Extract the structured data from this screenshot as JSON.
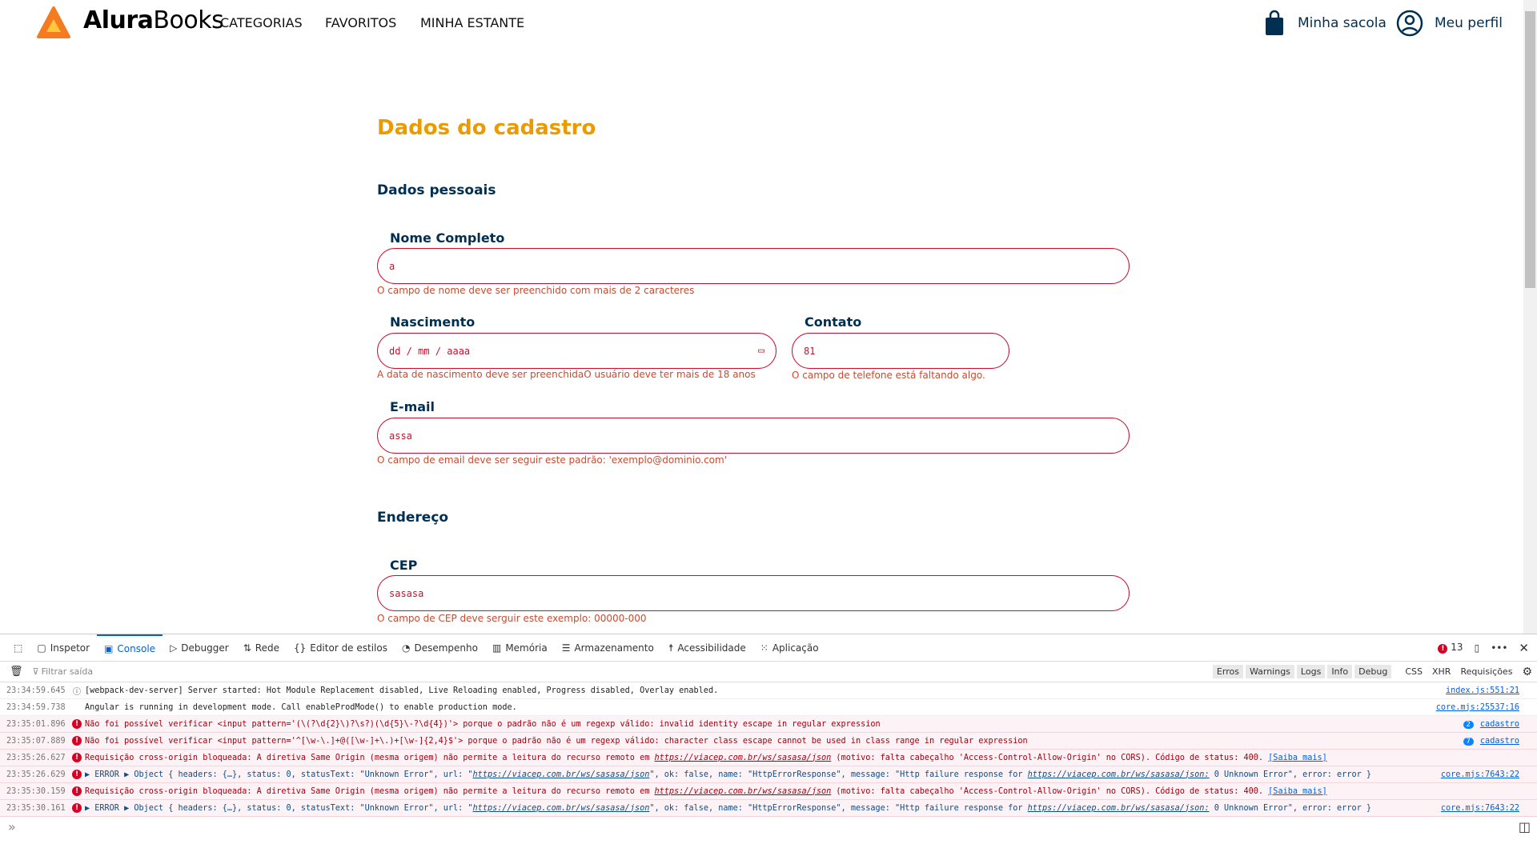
{
  "header": {
    "brand_bold": "Alura",
    "brand_rest": "Books",
    "nav": [
      "CATEGORIAS",
      "FAVORITOS",
      "MINHA ESTANTE"
    ],
    "bag": "Minha sacola",
    "profile": "Meu perfil"
  },
  "form": {
    "title": "Dados do cadastro",
    "personal": "Dados pessoais",
    "nome": {
      "label": "Nome Completo",
      "value": "a",
      "error": "O campo de nome deve ser preenchido com mais de 2 caracteres"
    },
    "nascimento": {
      "label": "Nascimento",
      "placeholder": "dd / mm / aaaa",
      "error": "A data de nascimento deve ser preenchidaO usuário deve ter mais de 18 anos"
    },
    "contato": {
      "label": "Contato",
      "value": "81",
      "error": "O campo de telefone está faltando algo."
    },
    "email": {
      "label": "E-mail",
      "value": "assa",
      "error": "O campo de email deve ser seguir este padrão: 'exemplo@dominio.com'"
    },
    "address": "Endereço",
    "cep": {
      "label": "CEP",
      "value": "sasasa",
      "error": "O campo de CEP deve serguir este exemplo: 00000-000"
    }
  },
  "devtools": {
    "tabs": [
      "Inspetor",
      "Console",
      "Debugger",
      "Rede",
      "Editor de estilos",
      "Desempenho",
      "Memória",
      "Armazenamento",
      "Acessibilidade",
      "Aplicação"
    ],
    "active_tab": "Console",
    "error_count": "13",
    "filter_placeholder": "Filtrar saída",
    "levels": [
      "Erros",
      "Warnings",
      "Logs",
      "Info",
      "Debug"
    ],
    "extras": [
      "CSS",
      "XHR",
      "Requisições"
    ],
    "logs": [
      {
        "time": "23:34:59.645",
        "type": "info",
        "text": "[webpack-dev-server] Server started: Hot Module Replacement disabled, Live Reloading enabled, Progress disabled, Overlay enabled.",
        "source": "index.js:551:21"
      },
      {
        "time": "23:34:59.738",
        "type": "log",
        "text": "Angular is running in development mode. Call enableProdMode() to enable production mode.",
        "source": "core.mjs:25537:16"
      },
      {
        "time": "23:35:01.896",
        "type": "error",
        "text": "Não foi possível verificar <input pattern='(\\(?\\d{2}\\)?\\s?)(\\d{5}\\-?\\d{4})'> porque o padrão não é um regexp válido: invalid identity escape in regular expression",
        "count": "2",
        "source": "cadastro"
      },
      {
        "time": "23:35:07.889",
        "type": "error",
        "text": "Não foi possível verificar <input pattern='^[\\w-\\.]+@([\\w-]+\\.)+[\\w-]{2,4}$'> porque o padrão não é um regexp válido: character class escape cannot be used in class range in regular expression",
        "count": "7",
        "source": "cadastro"
      },
      {
        "time": "23:35:26.627",
        "type": "error",
        "pre": "Requisição cross-origin bloqueada: A diretiva Same Origin (mesma origem) não permite a leitura do recurso remoto em ",
        "url": "https://viacep.com.br/ws/sasasa/json",
        "post": " (motivo: falta cabeçalho 'Access-Control-Allow-Origin' no CORS). Código de status: 400. ",
        "link": "[Saiba mais]"
      },
      {
        "time": "23:35:26.629",
        "type": "object",
        "pre": "▶ ERROR ▶ Object { headers: {…}, status: 0, statusText: \"Unknown Error\", url: \"",
        "url": "https://viacep.com.br/ws/sasasa/json",
        "mid": "\", ok: false, name: \"HttpErrorResponse\", message: \"Http failure response for ",
        "url2": "https://viacep.com.br/ws/sasasa/json:",
        "post": " 0 Unknown Error\", error: error }",
        "source": "core.mjs:7643:22"
      },
      {
        "time": "23:35:30.159",
        "type": "error",
        "pre": "Requisição cross-origin bloqueada: A diretiva Same Origin (mesma origem) não permite a leitura do recurso remoto em ",
        "url": "https://viacep.com.br/ws/sasasa/json",
        "post": " (motivo: falta cabeçalho 'Access-Control-Allow-Origin' no CORS). Código de status: 400. ",
        "link": "[Saiba mais]"
      },
      {
        "time": "23:35:30.161",
        "type": "object",
        "pre": "▶ ERROR ▶ Object { headers: {…}, status: 0, statusText: \"Unknown Error\", url: \"",
        "url": "https://viacep.com.br/ws/sasasa/json",
        "mid": "\", ok: false, name: \"HttpErrorResponse\", message: \"Http failure response for ",
        "url2": "https://viacep.com.br/ws/sasasa/json:",
        "post": " 0 Unknown Error\", error: error }",
        "source": "core.mjs:7643:22"
      }
    ]
  },
  "colors": {
    "accent": "#EB9B00",
    "primary": "#002F52",
    "error": "#C8102E"
  }
}
